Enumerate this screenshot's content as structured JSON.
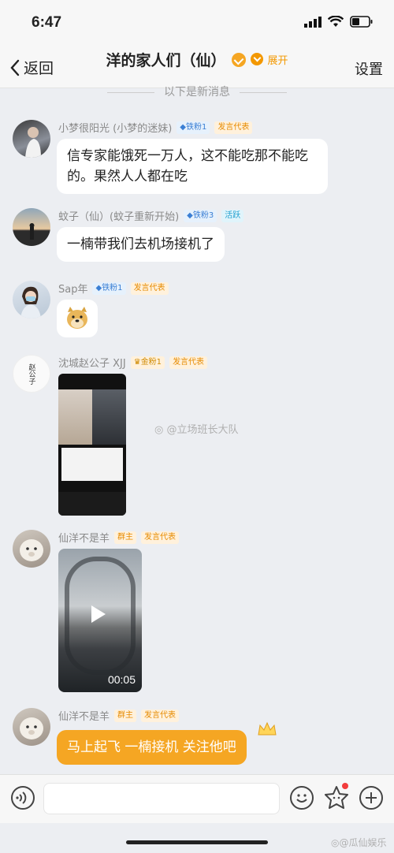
{
  "status": {
    "time": "6:47"
  },
  "nav": {
    "back_label": "返回",
    "title": "洋的家人们（仙）",
    "expand_label": "展开",
    "settings_label": "设置"
  },
  "divider": "以下是新消息",
  "messages": [
    {
      "name": "小梦很阳光 (小梦的迷妹)",
      "tags": [
        "铁粉1",
        "发言代表"
      ],
      "text": "信专家能饿死一万人，这不能吃那不能吃的。果然人人都在吃"
    },
    {
      "name": "蚊子（仙）(蚊子重新开始)",
      "tags": [
        "铁粉3",
        "活跃"
      ],
      "text": "一楠带我们去机场接机了"
    },
    {
      "name": "Sap年",
      "tags": [
        "铁粉1",
        "发言代表"
      ],
      "sticker": "doge"
    },
    {
      "name": "沈城赵公子 XJJ",
      "tags": [
        "金粉1",
        "发言代表"
      ],
      "avatar_text": "赵公子"
    },
    {
      "name": "仙洋不是羊",
      "tags": [
        "群主",
        "发言代表"
      ],
      "video_duration": "00:05"
    },
    {
      "name": "仙洋不是羊",
      "tags": [
        "群主",
        "发言代表"
      ],
      "text": "马上起飞 一楠接机 关注他吧"
    }
  ],
  "watermarks": {
    "middle": "@立场班长大队",
    "bottom": "@瓜仙娱乐"
  },
  "colors": {
    "accent": "#f5a623",
    "background": "#eceef2"
  }
}
